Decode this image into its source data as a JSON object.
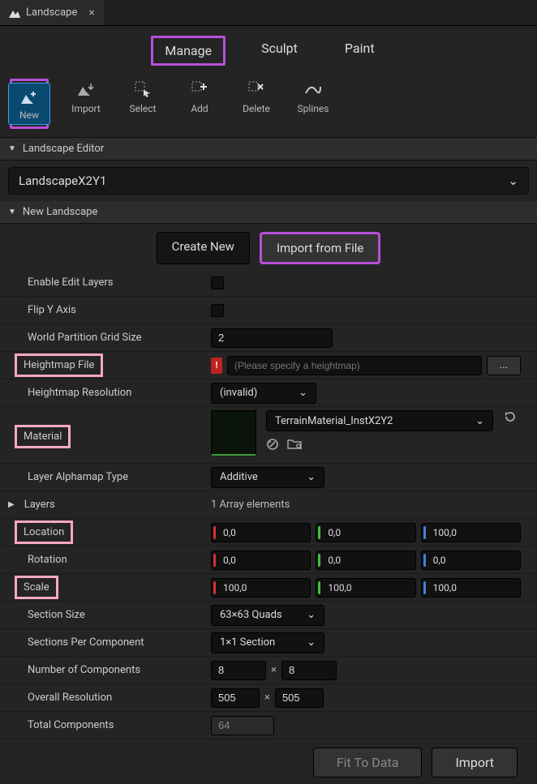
{
  "tab": {
    "title": "Landscape"
  },
  "modes": {
    "manage": "Manage",
    "sculpt": "Sculpt",
    "paint": "Paint"
  },
  "tools": {
    "new": "New",
    "import": "Import",
    "select": "Select",
    "add": "Add",
    "delete": "Delete",
    "splines": "Splines"
  },
  "sections": {
    "editor_title": "Landscape Editor",
    "editor_dropdown": "LandscapeX2Y1",
    "new_title": "New Landscape"
  },
  "create_import": {
    "create": "Create New",
    "import": "Import from File"
  },
  "props": {
    "enable_edit_layers": "Enable Edit Layers",
    "flip_y": "Flip Y Axis",
    "wp_grid": "World Partition Grid Size",
    "wp_grid_val": "2",
    "heightmap_file": "Heightmap File",
    "heightmap_placeholder": "(Please specify a heightmap)",
    "browse": "...",
    "heightmap_res": "Heightmap Resolution",
    "heightmap_res_val": "(invalid)",
    "material": "Material",
    "material_val": "TerrainMaterial_InstX2Y2",
    "layer_alphamap": "Layer Alphamap Type",
    "layer_alphamap_val": "Additive",
    "layers": "Layers",
    "layers_val": "1 Array elements",
    "location": "Location",
    "rotation": "Rotation",
    "scale": "Scale",
    "loc": {
      "x": "0,0",
      "y": "0,0",
      "z": "100,0"
    },
    "rot": {
      "x": "0,0",
      "y": "0,0",
      "z": "0,0"
    },
    "scl": {
      "x": "100,0",
      "y": "100,0",
      "z": "100,0"
    },
    "section_size": "Section Size",
    "section_size_val": "63×63 Quads",
    "sections_per": "Sections Per Component",
    "sections_per_val": "1×1 Section",
    "num_comp": "Number of Components",
    "num_comp_x": "8",
    "num_comp_y": "8",
    "overall_res": "Overall Resolution",
    "overall_x": "505",
    "overall_y": "505",
    "total_comp": "Total Components",
    "total_comp_val": "64"
  },
  "bottom": {
    "fit": "Fit To Data",
    "import": "Import"
  }
}
